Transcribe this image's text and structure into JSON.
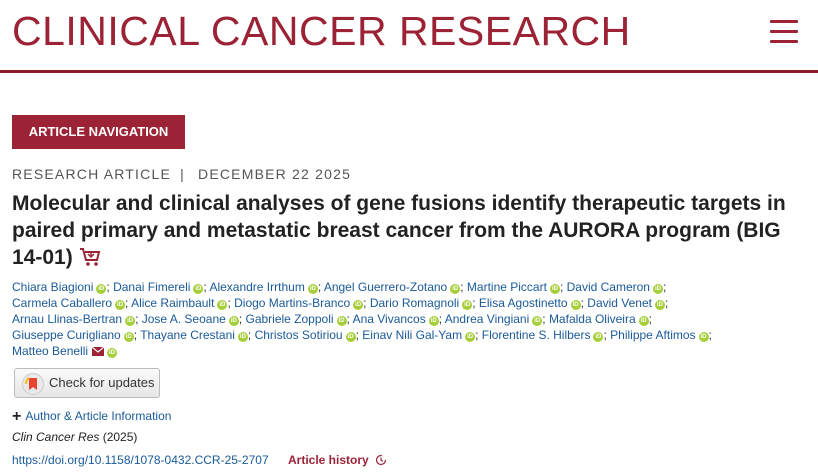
{
  "journal": {
    "title": "CLINICAL CANCER RESEARCH"
  },
  "nav": {
    "article_navigation": "ARTICLE NAVIGATION"
  },
  "article": {
    "type": "RESEARCH ARTICLE",
    "separator": "|",
    "date": "DECEMBER 22 2025",
    "title": "Molecular and clinical analyses of gene fusions identify therapeutic targets in paired primary and metastatic breast cancer from the AURORA program (BIG 14-01)"
  },
  "authors": [
    "Chiara Biagioni",
    "Danai Fimereli",
    "Alexandre Irrthum",
    "Angel Guerrero-Zotano",
    "Martine Piccart",
    "David Cameron",
    "Carmela Caballero",
    "Alice Raimbault",
    "Diogo Martins-Branco",
    "Dario Romagnoli",
    "Elisa Agostinetto",
    "David Venet",
    "Arnau Llinas-Bertran",
    "Jose A. Seoane",
    "Gabriele Zoppoli",
    "Ana Vivancos",
    "Andrea Vingiani",
    "Mafalda Oliveira",
    "Giuseppe Curigliano",
    "Thayane Crestani",
    "Christos Sotiriou",
    "Einav Nili Gal-Yam",
    "Florentine S. Hilbers",
    "Philippe Aftimos",
    "Matteo Benelli"
  ],
  "author_rows": [
    6,
    6,
    6,
    6,
    1
  ],
  "orcid_label": "iD",
  "check_updates": "Check for updates",
  "author_info": {
    "plus": "+",
    "label": "Author & Article Information"
  },
  "citation": {
    "journal": "Clin Cancer Res",
    "year": " (2025)"
  },
  "doi": "https://doi.org/10.1158/1078-0432.CCR-25-2707",
  "article_history": "Article history",
  "colors": {
    "brand": "#9b2335",
    "link": "#1a5a99",
    "orcid": "#a6ce39"
  },
  "icons": [
    "menu-icon",
    "cart-icon",
    "orcid-icon",
    "mail-icon",
    "check-updates-icon",
    "plus-icon",
    "history-icon"
  ]
}
